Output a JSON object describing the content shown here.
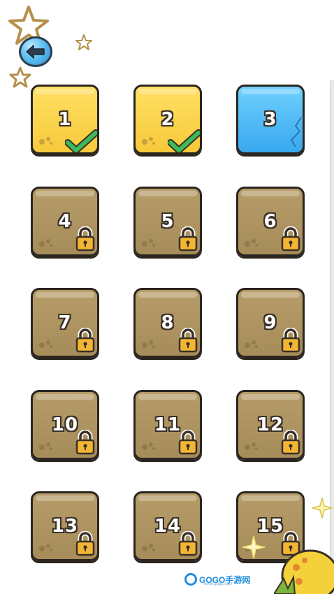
{
  "levels": [
    {
      "number": "1",
      "state": "completed"
    },
    {
      "number": "2",
      "state": "completed"
    },
    {
      "number": "3",
      "state": "current"
    },
    {
      "number": "4",
      "state": "locked"
    },
    {
      "number": "5",
      "state": "locked"
    },
    {
      "number": "6",
      "state": "locked"
    },
    {
      "number": "7",
      "state": "locked"
    },
    {
      "number": "8",
      "state": "locked"
    },
    {
      "number": "9",
      "state": "locked"
    },
    {
      "number": "10",
      "state": "locked"
    },
    {
      "number": "11",
      "state": "locked"
    },
    {
      "number": "12",
      "state": "locked"
    },
    {
      "number": "13",
      "state": "locked"
    },
    {
      "number": "14",
      "state": "locked"
    },
    {
      "number": "15",
      "state": "locked"
    }
  ],
  "watermark": {
    "brand": "GOGO手游网",
    "domain": "www.gogo.com"
  },
  "icons": {
    "back": "back-arrow-icon",
    "completed": "check-icon",
    "locked": "lock-icon"
  },
  "colors": {
    "completed": "#f7c93a",
    "current": "#38a8ee",
    "locked": "#a68c59",
    "check": "#3dbb5a",
    "lock": "#f2b632"
  }
}
